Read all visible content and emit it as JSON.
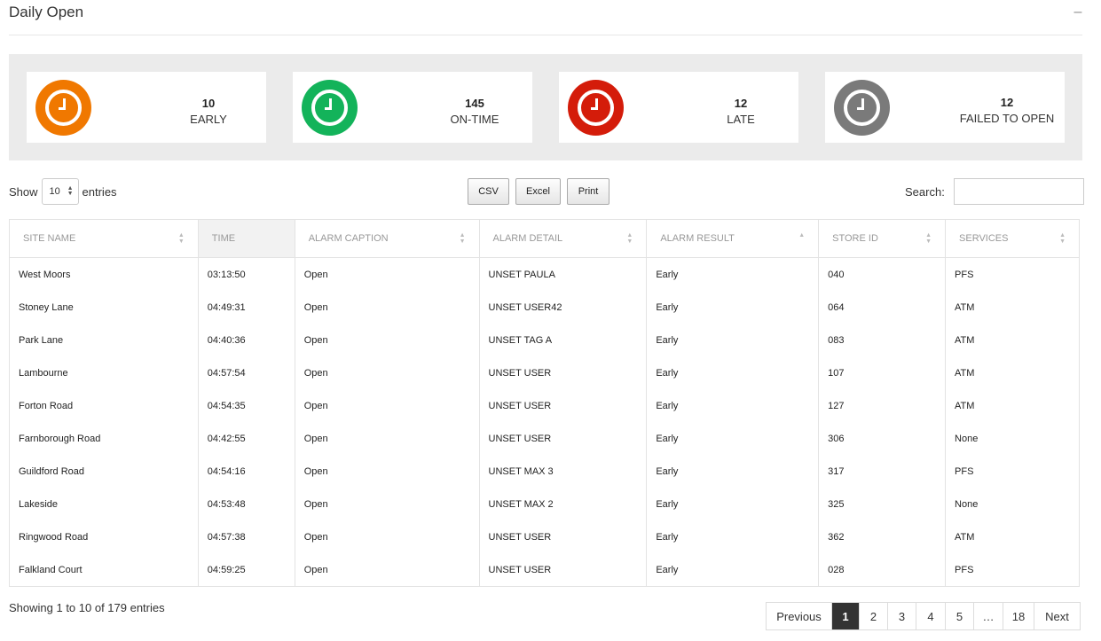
{
  "panel": {
    "title": "Daily Open",
    "collapse_glyph": "–"
  },
  "stats": [
    {
      "value": "10",
      "label": "EARLY",
      "color": "#f07800"
    },
    {
      "value": "145",
      "label": "ON-TIME",
      "color": "#13b35a"
    },
    {
      "value": "12",
      "label": "LATE",
      "color": "#d41c0a"
    },
    {
      "value": "12",
      "label": "FAILED TO OPEN",
      "color": "#7a7a7a"
    }
  ],
  "controls": {
    "show_label": "Show",
    "length_value": "10",
    "entries_label": "entries",
    "csv": "CSV",
    "excel": "Excel",
    "print": "Print",
    "search_label": "Search:",
    "search_value": ""
  },
  "table": {
    "columns": [
      "SITE NAME",
      "TIME",
      "ALARM CAPTION",
      "ALARM DETAIL",
      "ALARM RESULT",
      "STORE ID",
      "SERVICES"
    ],
    "rows": [
      [
        "West Moors",
        "03:13:50",
        "Open",
        "UNSET PAULA",
        "Early",
        "040",
        "PFS"
      ],
      [
        "Stoney Lane",
        "04:49:31",
        "Open",
        "UNSET USER42",
        "Early",
        "064",
        "ATM"
      ],
      [
        "Park Lane",
        "04:40:36",
        "Open",
        "UNSET TAG A",
        "Early",
        "083",
        "ATM"
      ],
      [
        "Lambourne",
        "04:57:54",
        "Open",
        "UNSET USER",
        "Early",
        "107",
        "ATM"
      ],
      [
        "Forton Road",
        "04:54:35",
        "Open",
        "UNSET USER",
        "Early",
        "127",
        "ATM"
      ],
      [
        "Farnborough Road",
        "04:42:55",
        "Open",
        "UNSET USER",
        "Early",
        "306",
        "None"
      ],
      [
        "Guildford Road",
        "04:54:16",
        "Open",
        "UNSET MAX 3",
        "Early",
        "317",
        "PFS"
      ],
      [
        "Lakeside",
        "04:53:48",
        "Open",
        "UNSET MAX 2",
        "Early",
        "325",
        "None"
      ],
      [
        "Ringwood Road",
        "04:57:38",
        "Open",
        "UNSET USER",
        "Early",
        "362",
        "ATM"
      ],
      [
        "Falkland Court",
        "04:59:25",
        "Open",
        "UNSET USER",
        "Early",
        "028",
        "PFS"
      ]
    ]
  },
  "footer": {
    "info": "Showing 1 to 10 of 179 entries",
    "pages": [
      "Previous",
      "1",
      "2",
      "3",
      "4",
      "5",
      "…",
      "18",
      "Next"
    ],
    "active_page": "1"
  }
}
